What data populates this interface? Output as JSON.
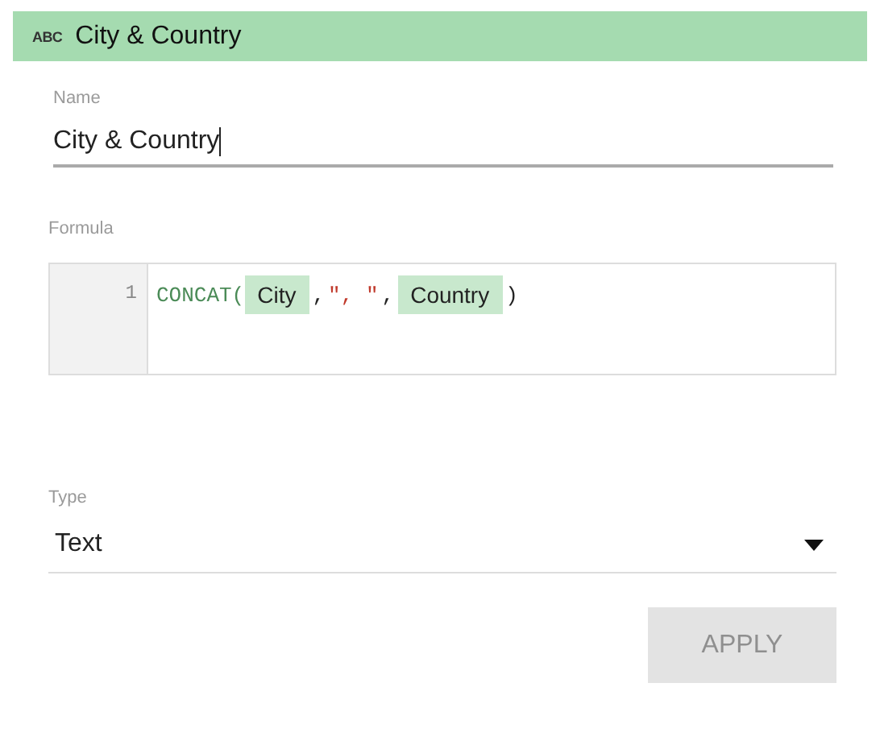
{
  "header": {
    "type_badge": "ABC",
    "title": "City & Country"
  },
  "name_field": {
    "label": "Name",
    "value": "City & Country",
    "focused": true
  },
  "formula": {
    "label": "Formula",
    "lines": [
      {
        "number": "1",
        "tokens": [
          {
            "kind": "function",
            "text": "CONCAT("
          },
          {
            "kind": "field",
            "text": "City"
          },
          {
            "kind": "punct",
            "text": ","
          },
          {
            "kind": "string",
            "text": "\", \""
          },
          {
            "kind": "punct",
            "text": ","
          },
          {
            "kind": "field",
            "text": "Country"
          },
          {
            "kind": "punct",
            "text": ")"
          }
        ]
      }
    ]
  },
  "type_field": {
    "label": "Type",
    "value": "Text"
  },
  "apply_button": {
    "label": "APPLY",
    "disabled": true
  }
}
